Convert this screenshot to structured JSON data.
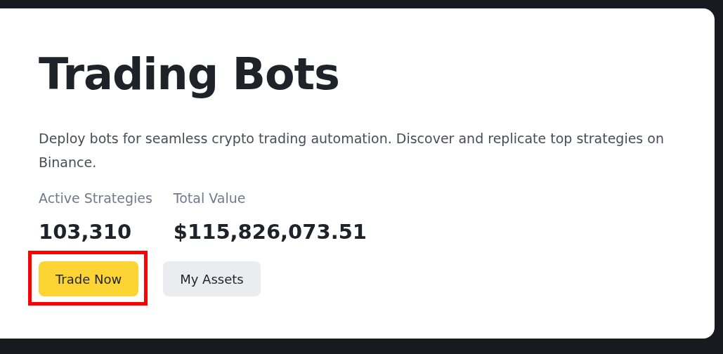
{
  "title": "Trading Bots",
  "description": "Deploy bots for seamless crypto trading automation. Discover and replicate top strategies on Binance.",
  "stats": [
    {
      "label": "Active Strategies",
      "value": "103,310"
    },
    {
      "label": "Total Value",
      "value": "$115,826,073.51"
    }
  ],
  "buttons": [
    {
      "label": "Trade Now",
      "kind": "primary",
      "highlighted": true
    },
    {
      "label": "My Assets",
      "kind": "secondary",
      "highlighted": false
    }
  ]
}
